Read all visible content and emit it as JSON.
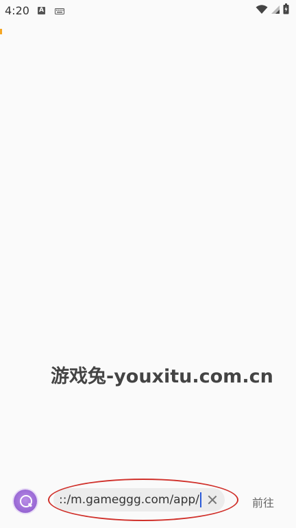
{
  "status_bar": {
    "time": "4:20",
    "notification_letter": "A",
    "icons": [
      "a-notification-icon",
      "keyboard-icon",
      "wifi-icon",
      "signal-icon",
      "battery-icon"
    ]
  },
  "watermark": {
    "text": "游戏兔-youxitu.com.cn"
  },
  "bottom_bar": {
    "url_value": "::/m.gameggg.com/app/",
    "go_label": "前往",
    "accent_color": "#9b6bd6",
    "annotation_color": "#d0302a"
  }
}
